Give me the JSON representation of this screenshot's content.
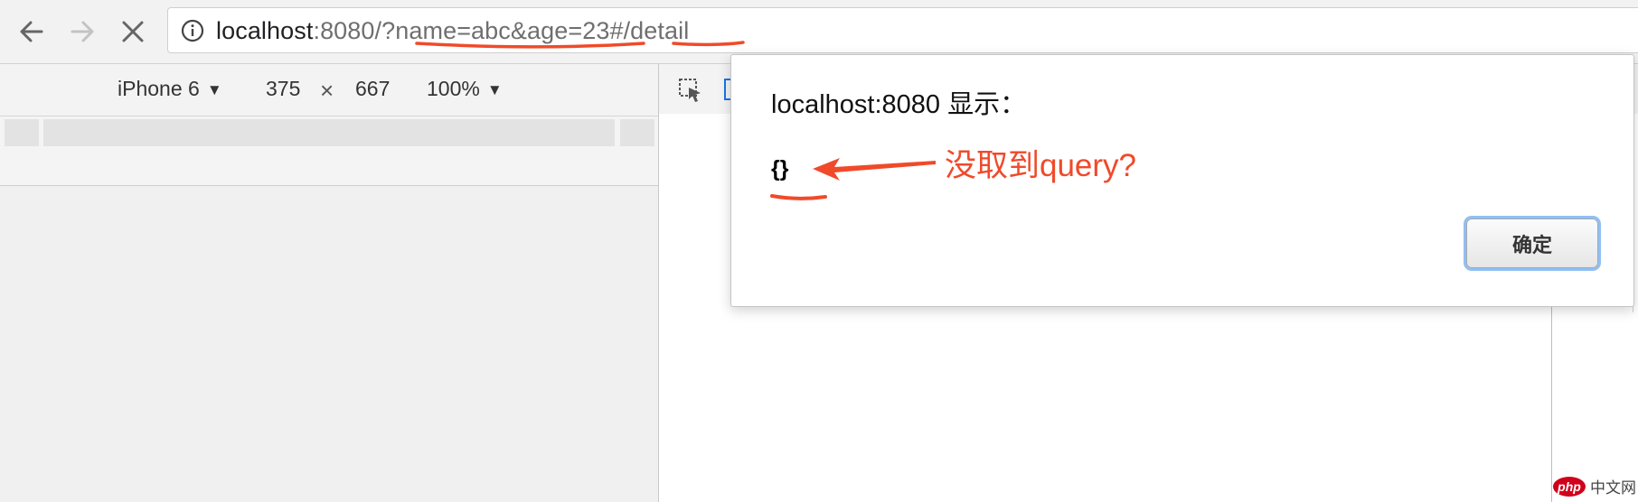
{
  "browser": {
    "url_host": "localhost",
    "url_rest": ":8080/?name=abc&age=23#/detail"
  },
  "device_toolbar": {
    "device": "iPhone 6",
    "width": "375",
    "times": "×",
    "height": "667",
    "zoom": "100%"
  },
  "alert": {
    "title": "localhost:8080 显示：",
    "message": "{}",
    "ok_label": "确定"
  },
  "annotation": {
    "text": "没取到query?",
    "color": "#f04a2a"
  },
  "watermark": {
    "logo": "php",
    "text": "中文网"
  },
  "colors": {
    "annotation_red": "#f04a2a",
    "focus_ring": "#8fbff5"
  }
}
